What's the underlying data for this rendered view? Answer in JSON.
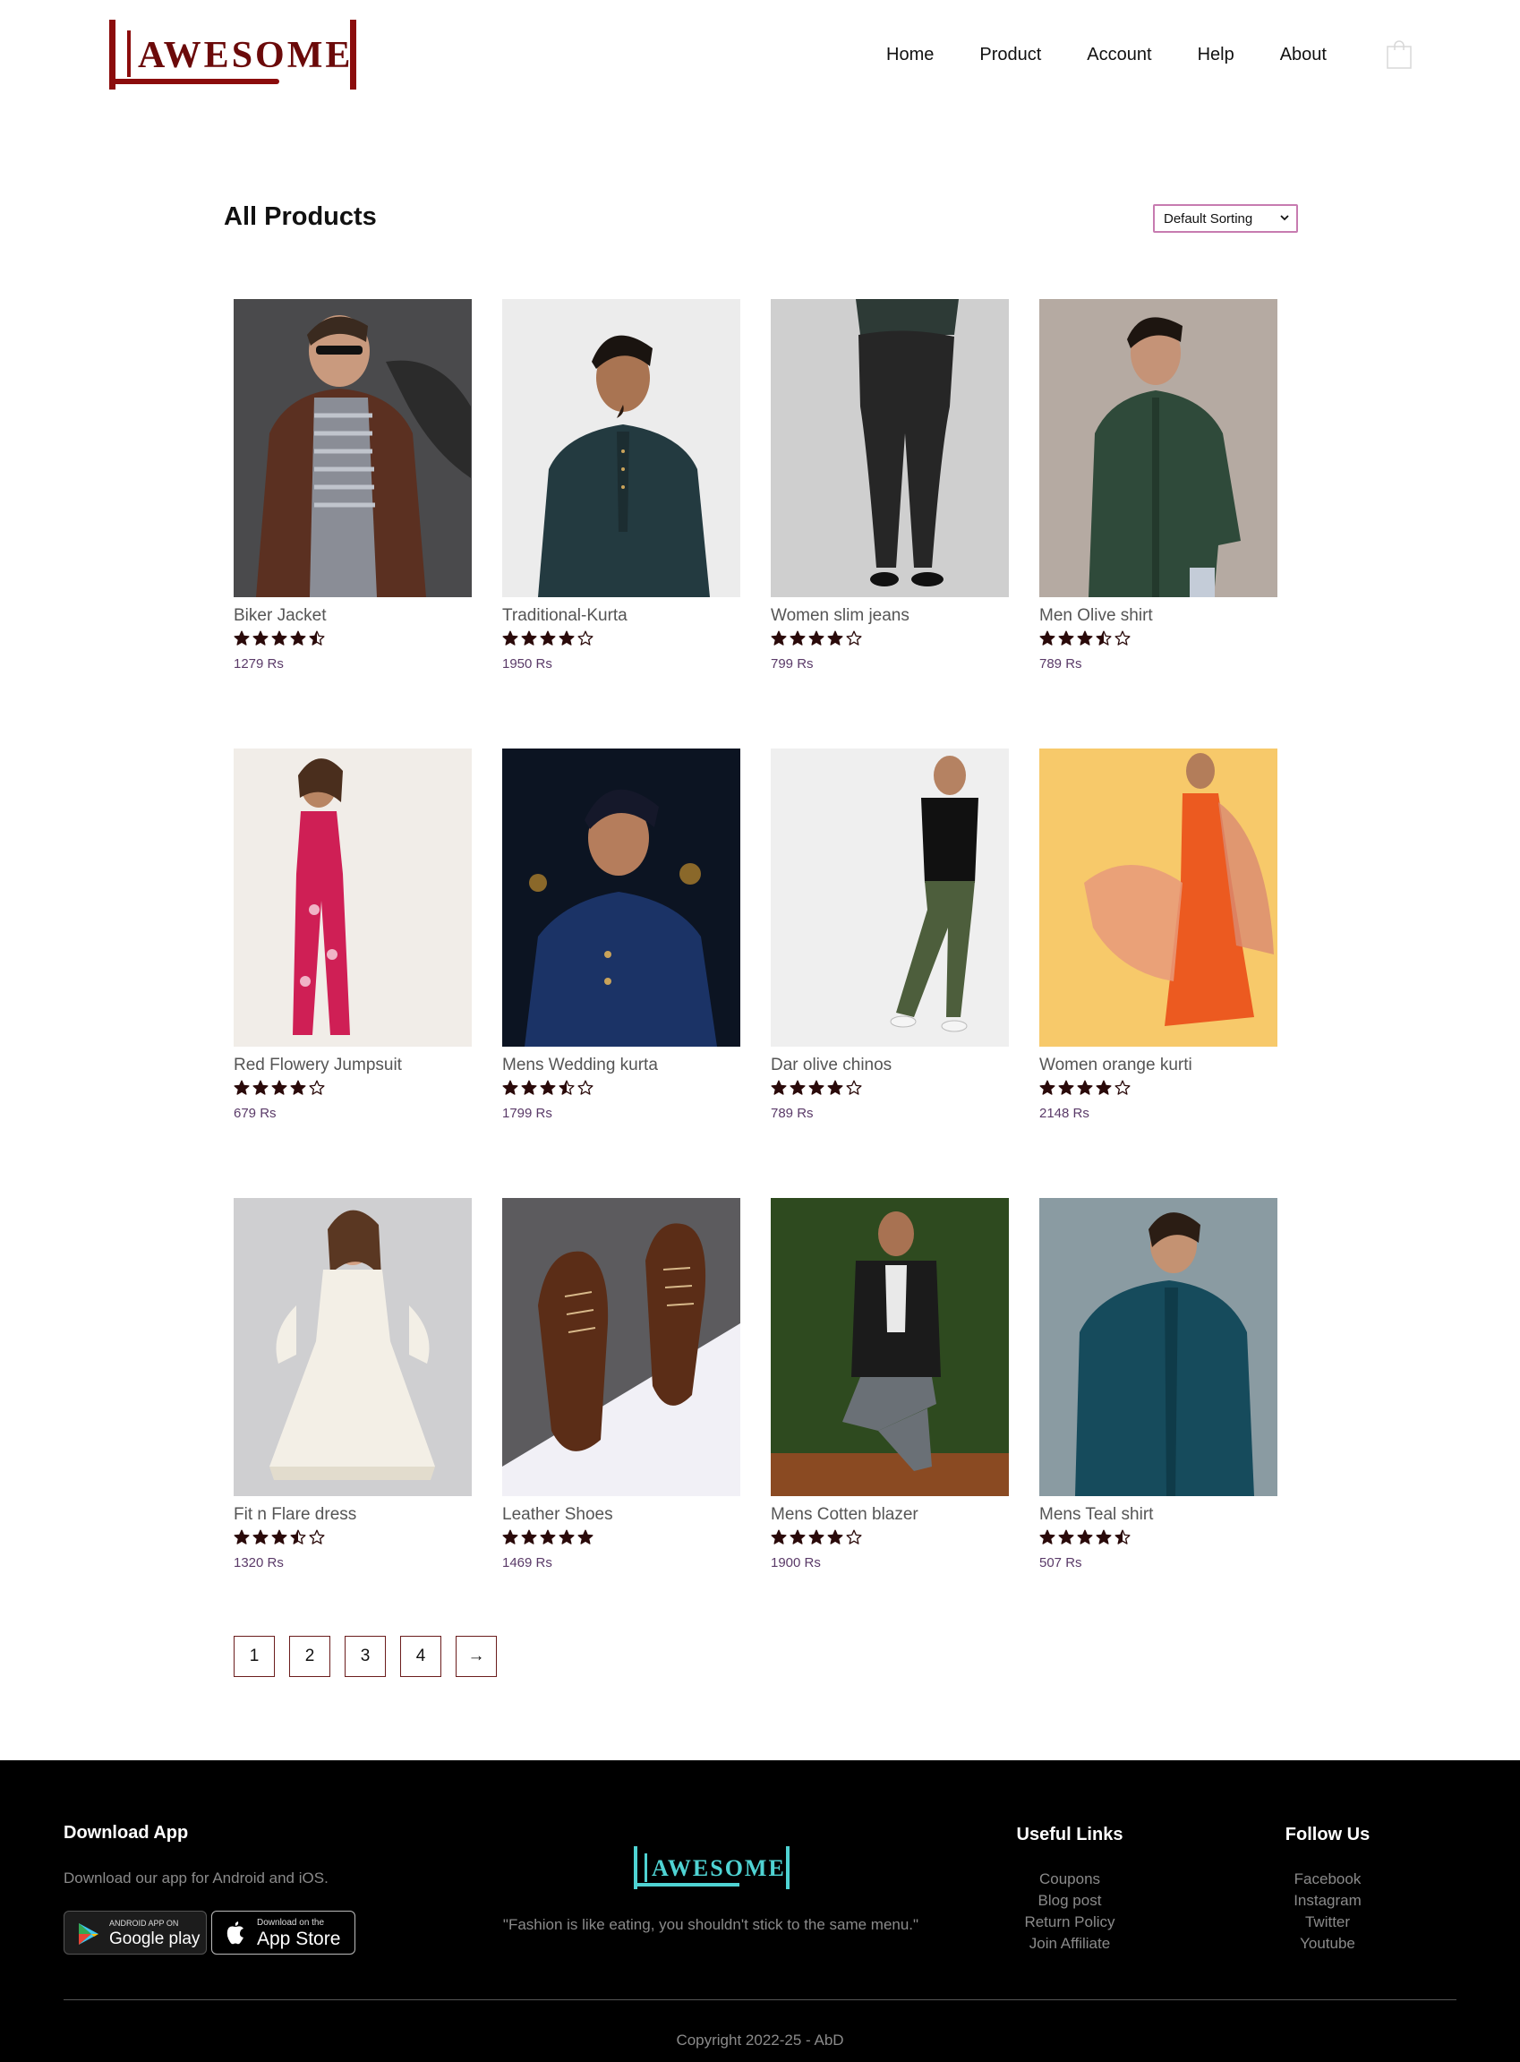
{
  "brand": {
    "logo_text": "AWESOME",
    "accent": "#8b0c0c",
    "footer_accent": "#4fd3d3"
  },
  "nav": {
    "items": [
      "Home",
      "Product",
      "Account",
      "Help",
      "About"
    ],
    "cart_icon": "shopping-bag-icon"
  },
  "page": {
    "title": "All Products",
    "sort_label": "Default Sorting"
  },
  "products": [
    {
      "name": "Biker Jacket",
      "rating": 4.5,
      "price": "1279 Rs",
      "image": "man-in-brown-leather-jacket"
    },
    {
      "name": "Traditional-Kurta",
      "rating": 4,
      "price": "1950 Rs",
      "image": "man-in-dark-kurta"
    },
    {
      "name": "Women slim jeans",
      "rating": 4,
      "price": "799 Rs",
      "image": "woman-black-jeans-back"
    },
    {
      "name": "Men Olive shirt",
      "rating": 3.5,
      "price": "789 Rs",
      "image": "man-in-green-shirt"
    },
    {
      "name": "Red Flowery Jumpsuit",
      "rating": 4,
      "price": "679 Rs",
      "image": "woman-red-floral-jumpsuit"
    },
    {
      "name": "Mens Wedding kurta",
      "rating": 3.5,
      "price": "1799 Rs",
      "image": "man-in-blue-wedding-kurta"
    },
    {
      "name": "Dar olive chinos",
      "rating": 4,
      "price": "789 Rs",
      "image": "man-olive-chinos"
    },
    {
      "name": "Women orange kurti",
      "rating": 4,
      "price": "2148 Rs",
      "image": "woman-orange-kurti"
    },
    {
      "name": "Fit n Flare dress",
      "rating": 3.5,
      "price": "1320 Rs",
      "image": "woman-white-dress"
    },
    {
      "name": "Leather Shoes",
      "rating": 5,
      "price": "1469 Rs",
      "image": "brown-leather-shoes"
    },
    {
      "name": "Mens Cotten blazer",
      "rating": 4,
      "price": "1900 Rs",
      "image": "man-black-blazer"
    },
    {
      "name": "Mens Teal shirt",
      "rating": 4.5,
      "price": "507 Rs",
      "image": "man-teal-shirt"
    }
  ],
  "pagination": [
    "1",
    "2",
    "3",
    "4",
    "→"
  ],
  "footer": {
    "download_title": "Download App",
    "download_text": "Download our app for Android and iOS.",
    "google_play_small": "ANDROID APP ON",
    "google_play_big": "Google play",
    "app_store_small": "Download on the",
    "app_store_big": "App Store",
    "logo_text": "AWESOME",
    "quote": "\"Fashion is like eating, you shouldn't stick to the same menu.\"",
    "useful_links_title": "Useful Links",
    "useful_links": [
      "Coupons",
      "Blog post",
      "Return Policy",
      "Join Affiliate"
    ],
    "follow_title": "Follow Us",
    "follow_links": [
      "Facebook",
      "Instagram",
      "Twitter",
      "Youtube"
    ],
    "copyright": "Copyright 2022-25 - AbD"
  }
}
